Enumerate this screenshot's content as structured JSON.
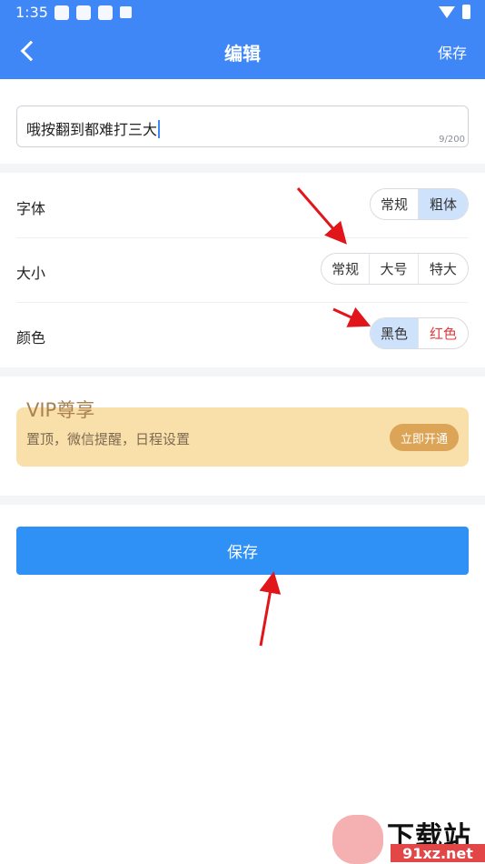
{
  "status": {
    "time": "1:35"
  },
  "nav": {
    "title": "编辑",
    "save": "保存"
  },
  "input": {
    "value": "哦按翻到都难打三大",
    "count": "9/200"
  },
  "options": {
    "font": {
      "label": "字体",
      "items": [
        "常规",
        "粗体"
      ],
      "selected": "粗体"
    },
    "size": {
      "label": "大小",
      "items": [
        "常规",
        "大号",
        "特大"
      ]
    },
    "color": {
      "label": "颜色",
      "items": [
        "黑色",
        "红色"
      ],
      "selected": "黑色"
    }
  },
  "vip": {
    "title": "VIP尊享",
    "subtitle": "置顶，微信提醒，日程设置",
    "button": "立即开通"
  },
  "save_button": "保存",
  "watermark": {
    "brand": "下载站",
    "url": "91xz.net"
  },
  "colors": {
    "header": "#3f86f7",
    "save": "#2f91f6",
    "selected": "#cfe2fb",
    "vip_bg": "#f9dfaa",
    "vip_btn": "#dba456",
    "red_option": "#e03a3a",
    "annotation_arrow": "#e0161b"
  }
}
